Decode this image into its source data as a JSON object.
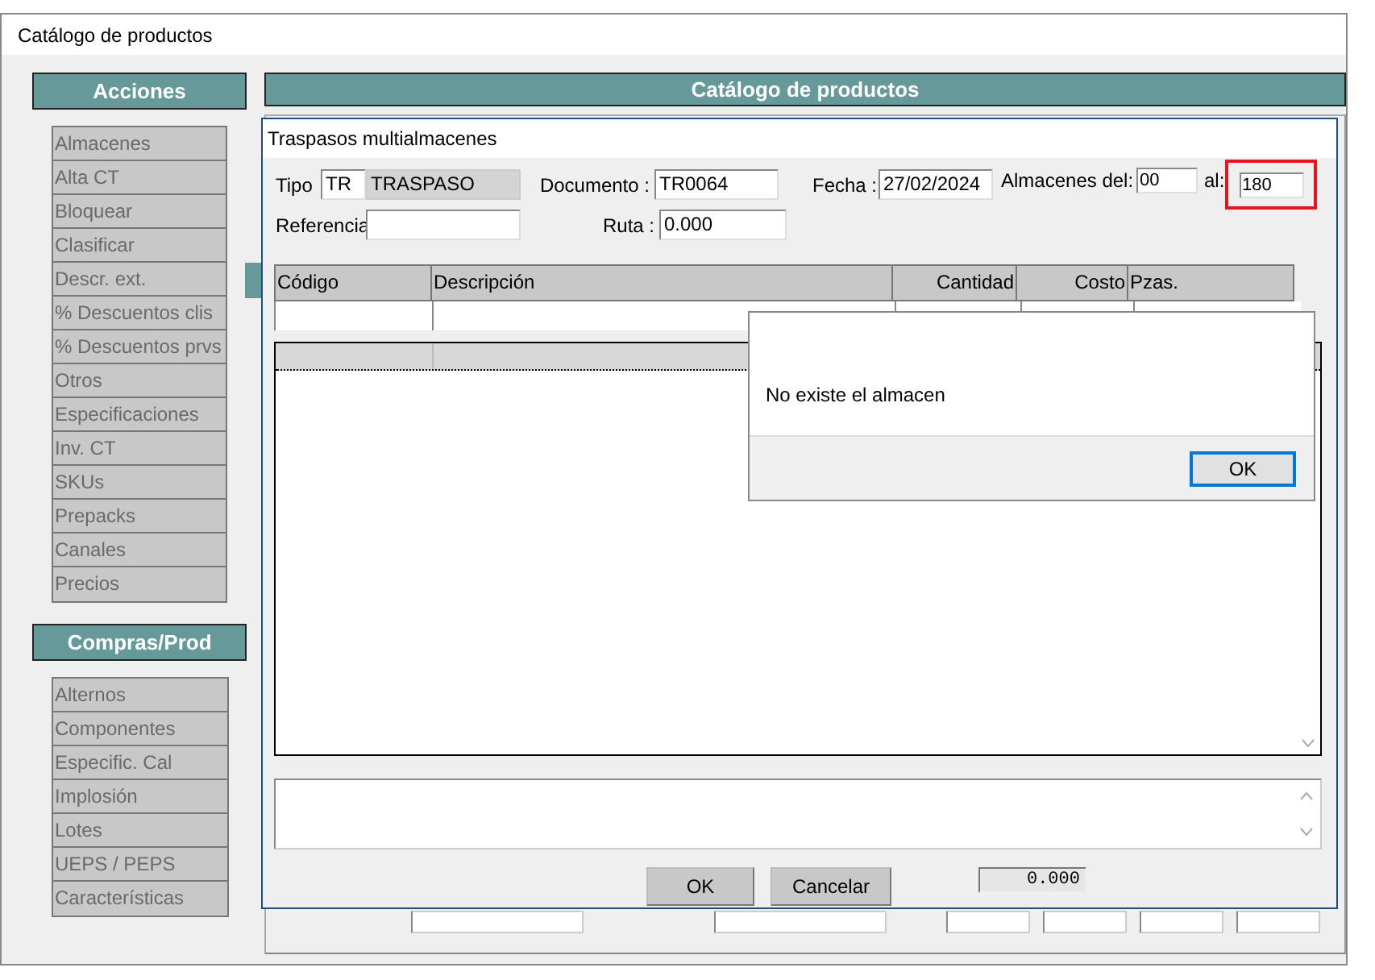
{
  "window": {
    "title": "Catálogo de productos"
  },
  "sidebar": {
    "sections": [
      {
        "title": "Acciones",
        "items": [
          "Almacenes",
          "Alta CT",
          "Bloquear",
          "Clasificar",
          "Descr. ext.",
          "%  Descuentos clis",
          "%  Descuentos prvs",
          "Otros",
          "Especificaciones",
          "Inv. CT",
          "SKUs",
          "Prepacks",
          "Canales",
          "Precios"
        ]
      },
      {
        "title": "Compras/Prod",
        "items": [
          "Alternos",
          "Componentes",
          "Especific. Cal",
          "Implosión",
          "Lotes",
          "UEPS / PEPS",
          "Características"
        ]
      }
    ]
  },
  "main": {
    "header": "Catálogo de productos"
  },
  "dialog": {
    "title": "Traspasos multialmacenes",
    "tipo": {
      "label": "Tipo",
      "code": "TR",
      "name": "TRASPASO"
    },
    "documento": {
      "label": "Documento :",
      "value": "TR0064"
    },
    "fecha": {
      "label": "Fecha :",
      "value": "27/02/2024"
    },
    "almacenes": {
      "label": "Almacenes del:",
      "from": "00",
      "to_label": "al:",
      "to": "180",
      "highlighted": true
    },
    "referencia": {
      "label": "Referencia"
    },
    "ruta": {
      "label": "Ruta :",
      "value": "0.000"
    },
    "table": {
      "columns": [
        "Código",
        "Descripción",
        "Cantidad",
        "Costo",
        "Pzas."
      ]
    },
    "buttons": [
      "OK",
      "Cancelar"
    ],
    "total": "0.000"
  },
  "message_box": {
    "text": "No existe el almacen",
    "button": "OK"
  }
}
